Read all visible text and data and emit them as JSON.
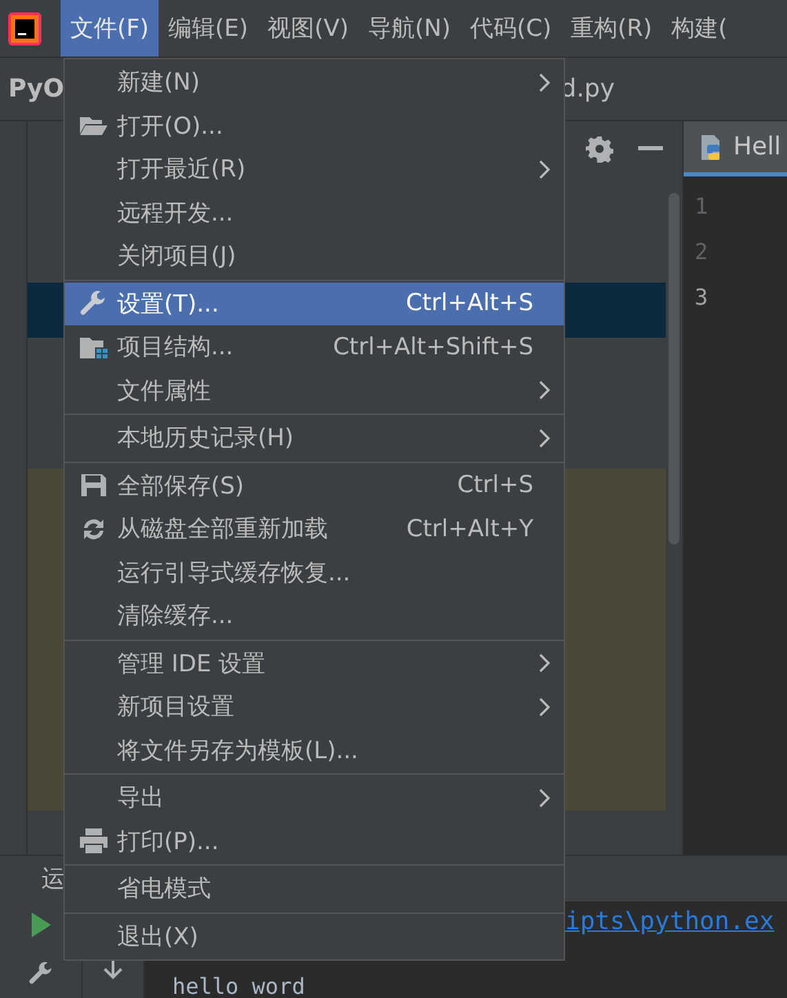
{
  "menubar": [
    {
      "label": "文件(F)",
      "selected": true
    },
    {
      "label": "编辑(E)",
      "selected": false
    },
    {
      "label": "视图(V)",
      "selected": false
    },
    {
      "label": "导航(N)",
      "selected": false
    },
    {
      "label": "代码(C)",
      "selected": false
    },
    {
      "label": "重构(R)",
      "selected": false
    },
    {
      "label": "构建(",
      "selected": false
    }
  ],
  "navbar": {
    "project": "PyO",
    "file": "d.py"
  },
  "editor": {
    "tab": "Hell",
    "line_numbers": [
      "1",
      "2",
      "3"
    ]
  },
  "run_panel": {
    "tab": "运",
    "link": "ipts\\python.ex",
    "output": "hello word"
  },
  "file_menu": [
    {
      "kind": "plain",
      "label": "新建(N)",
      "submenu": true,
      "selected": false
    },
    {
      "kind": "open",
      "label": "打开(O)...",
      "submenu": false,
      "selected": false
    },
    {
      "kind": "plain",
      "label": "打开最近(R)",
      "submenu": true,
      "selected": false
    },
    {
      "kind": "plain",
      "label": "远程开发...",
      "submenu": false,
      "selected": false
    },
    {
      "kind": "plain",
      "label": "关闭项目(J)",
      "submenu": false,
      "selected": false
    },
    {
      "kind": "separator"
    },
    {
      "kind": "settings",
      "label": "设置(T)...",
      "shortcut": "Ctrl+Alt+S",
      "submenu": false,
      "selected": true
    },
    {
      "kind": "structure",
      "label": "项目结构...",
      "shortcut": "Ctrl+Alt+Shift+S",
      "submenu": false,
      "selected": false
    },
    {
      "kind": "plain",
      "label": "文件属性",
      "submenu": true,
      "selected": false
    },
    {
      "kind": "separator"
    },
    {
      "kind": "plain",
      "label": "本地历史记录(H)",
      "submenu": true,
      "selected": false
    },
    {
      "kind": "separator"
    },
    {
      "kind": "save",
      "label": "全部保存(S)",
      "shortcut": "Ctrl+S",
      "submenu": false,
      "selected": false
    },
    {
      "kind": "reload",
      "label": "从磁盘全部重新加载",
      "shortcut": "Ctrl+Alt+Y",
      "submenu": false,
      "selected": false
    },
    {
      "kind": "plain",
      "label": "运行引导式缓存恢复...",
      "submenu": false,
      "selected": false
    },
    {
      "kind": "plain",
      "label": "清除缓存...",
      "submenu": false,
      "selected": false
    },
    {
      "kind": "separator"
    },
    {
      "kind": "plain",
      "label": "管理 IDE 设置",
      "submenu": true,
      "selected": false
    },
    {
      "kind": "plain",
      "label": "新项目设置",
      "submenu": true,
      "selected": false
    },
    {
      "kind": "plain",
      "label": "将文件另存为模板(L)...",
      "submenu": false,
      "selected": false
    },
    {
      "kind": "separator"
    },
    {
      "kind": "plain",
      "label": "导出",
      "submenu": true,
      "selected": false
    },
    {
      "kind": "print",
      "label": "打印(P)...",
      "submenu": false,
      "selected": false
    },
    {
      "kind": "separator"
    },
    {
      "kind": "plain",
      "label": "省电模式",
      "submenu": false,
      "selected": false
    },
    {
      "kind": "separator"
    },
    {
      "kind": "plain",
      "label": "退出(X)",
      "submenu": false,
      "selected": false
    }
  ]
}
